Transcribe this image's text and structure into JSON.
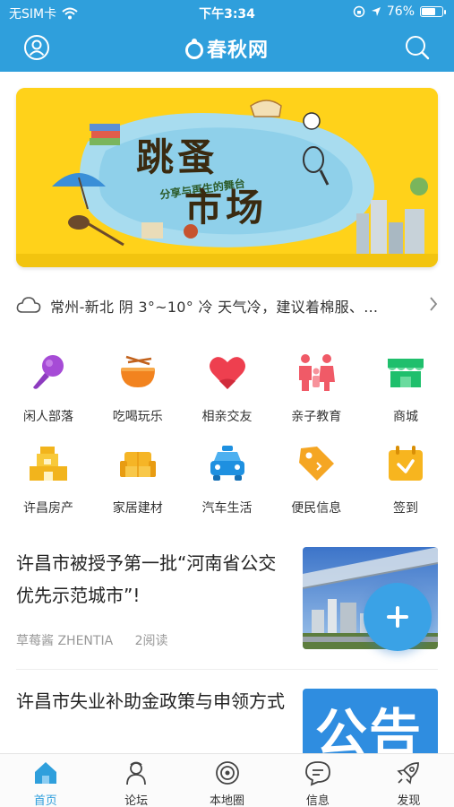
{
  "status_bar": {
    "carrier": "无SIM卡",
    "time": "下午3:34",
    "battery_text": "76%",
    "battery_level": 0.76
  },
  "header": {
    "logo_text": "春秋网",
    "user_icon": "user-icon",
    "search_icon": "search-icon",
    "bg_color": "#2f9fdc"
  },
  "banner": {
    "subtitle": "分享与再生的舞台",
    "title_line1": "跳蚤",
    "title_line2": "市场"
  },
  "weather": {
    "text": "常州-新北 阴 3°~10° 冷 天气冷，建议着棉服、…"
  },
  "grid": {
    "row1": [
      {
        "label": "闲人部落",
        "icon": "microphone-icon"
      },
      {
        "label": "吃喝玩乐",
        "icon": "noodle-bowl-icon"
      },
      {
        "label": "相亲交友",
        "icon": "heart-icon"
      },
      {
        "label": "亲子教育",
        "icon": "family-icon"
      },
      {
        "label": "商城",
        "icon": "shop-icon"
      }
    ],
    "row2": [
      {
        "label": "许昌房产",
        "icon": "building-icon"
      },
      {
        "label": "家居建材",
        "icon": "sofa-icon"
      },
      {
        "label": "汽车生活",
        "icon": "car-icon"
      },
      {
        "label": "便民信息",
        "icon": "tag-icon"
      },
      {
        "label": "签到",
        "icon": "calendar-check-icon"
      }
    ]
  },
  "articles": [
    {
      "title": "许昌市被授予第一批“河南省公交优先示范城市”!",
      "author": "草莓酱 ZHENTIA",
      "reads": "2阅读"
    },
    {
      "title": "许昌市失业补助金政策与申领方式",
      "thumb_text": "公告"
    }
  ],
  "tabbar": [
    {
      "label": "首页",
      "icon": "home-icon",
      "active": true
    },
    {
      "label": "论坛",
      "icon": "forum-icon",
      "active": false
    },
    {
      "label": "本地圈",
      "icon": "local-circle-icon",
      "active": false
    },
    {
      "label": "信息",
      "icon": "message-icon",
      "active": false
    },
    {
      "label": "发现",
      "icon": "rocket-icon",
      "active": false
    }
  ]
}
